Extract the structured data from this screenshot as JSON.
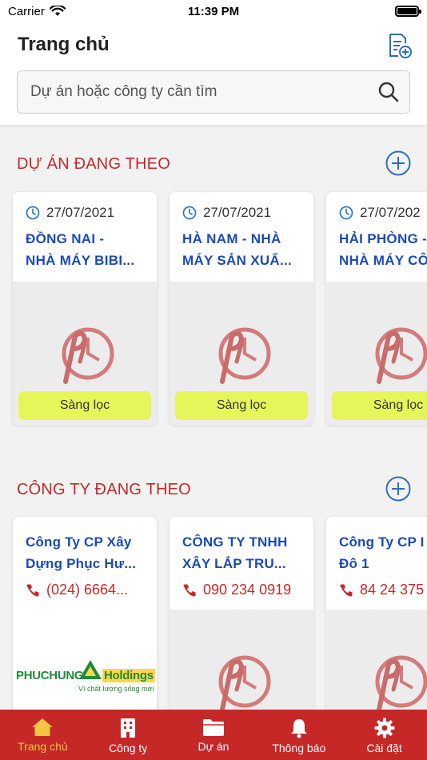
{
  "status_bar": {
    "carrier": "Carrier",
    "time": "11:39 PM"
  },
  "header": {
    "title": "Trang chủ",
    "search_placeholder": "Dự án hoặc công ty cần tìm"
  },
  "projects_section": {
    "title": "DỰ ÁN ĐANG THEO",
    "filter_label": "Sàng lọc",
    "cards": [
      {
        "date": "27/07/2021",
        "title_line1": "ĐỒNG NAI -",
        "title_line2": "NHÀ MÁY BIBI..."
      },
      {
        "date": "27/07/2021",
        "title_line1": "HÀ NAM - NHÀ",
        "title_line2": "MÁY SẢN XUẤ..."
      },
      {
        "date": "27/07/202",
        "title_line1": "HẢI PHÒNG -",
        "title_line2": "NHÀ MÁY CÔ"
      }
    ]
  },
  "companies_section": {
    "title": "CÔNG TY ĐANG THEO",
    "cards": [
      {
        "name_line1": "Công Ty CP Xây",
        "name_line2": "Dựng Phục Hư...",
        "phone": "(024) 6664...",
        "logo_text": "PHUCHUNG",
        "logo_text2": "Holdings",
        "logo_slogan": "Vì chất lượng sống mới"
      },
      {
        "name_line1": "CÔNG TY TNHH",
        "name_line2": "XÂY LẮP TRU...",
        "phone": "090 234 0919"
      },
      {
        "name_line1": "Công Ty CP I",
        "name_line2": "Đô 1",
        "phone": "84 24 375"
      }
    ]
  },
  "tab_bar": {
    "items": [
      {
        "label": "Trang chủ",
        "icon": "home-icon",
        "active": true
      },
      {
        "label": "Công ty",
        "icon": "building-icon",
        "active": false
      },
      {
        "label": "Dự án",
        "icon": "folder-icon",
        "active": false
      },
      {
        "label": "Thông báo",
        "icon": "bell-icon",
        "active": false
      },
      {
        "label": "Cài đặt",
        "icon": "gear-icon",
        "active": false
      }
    ]
  },
  "colors": {
    "accent_red": "#c62828",
    "link_blue": "#1a4ab8",
    "filter_yellow": "#e6f55a",
    "tab_active": "#f5c542"
  }
}
